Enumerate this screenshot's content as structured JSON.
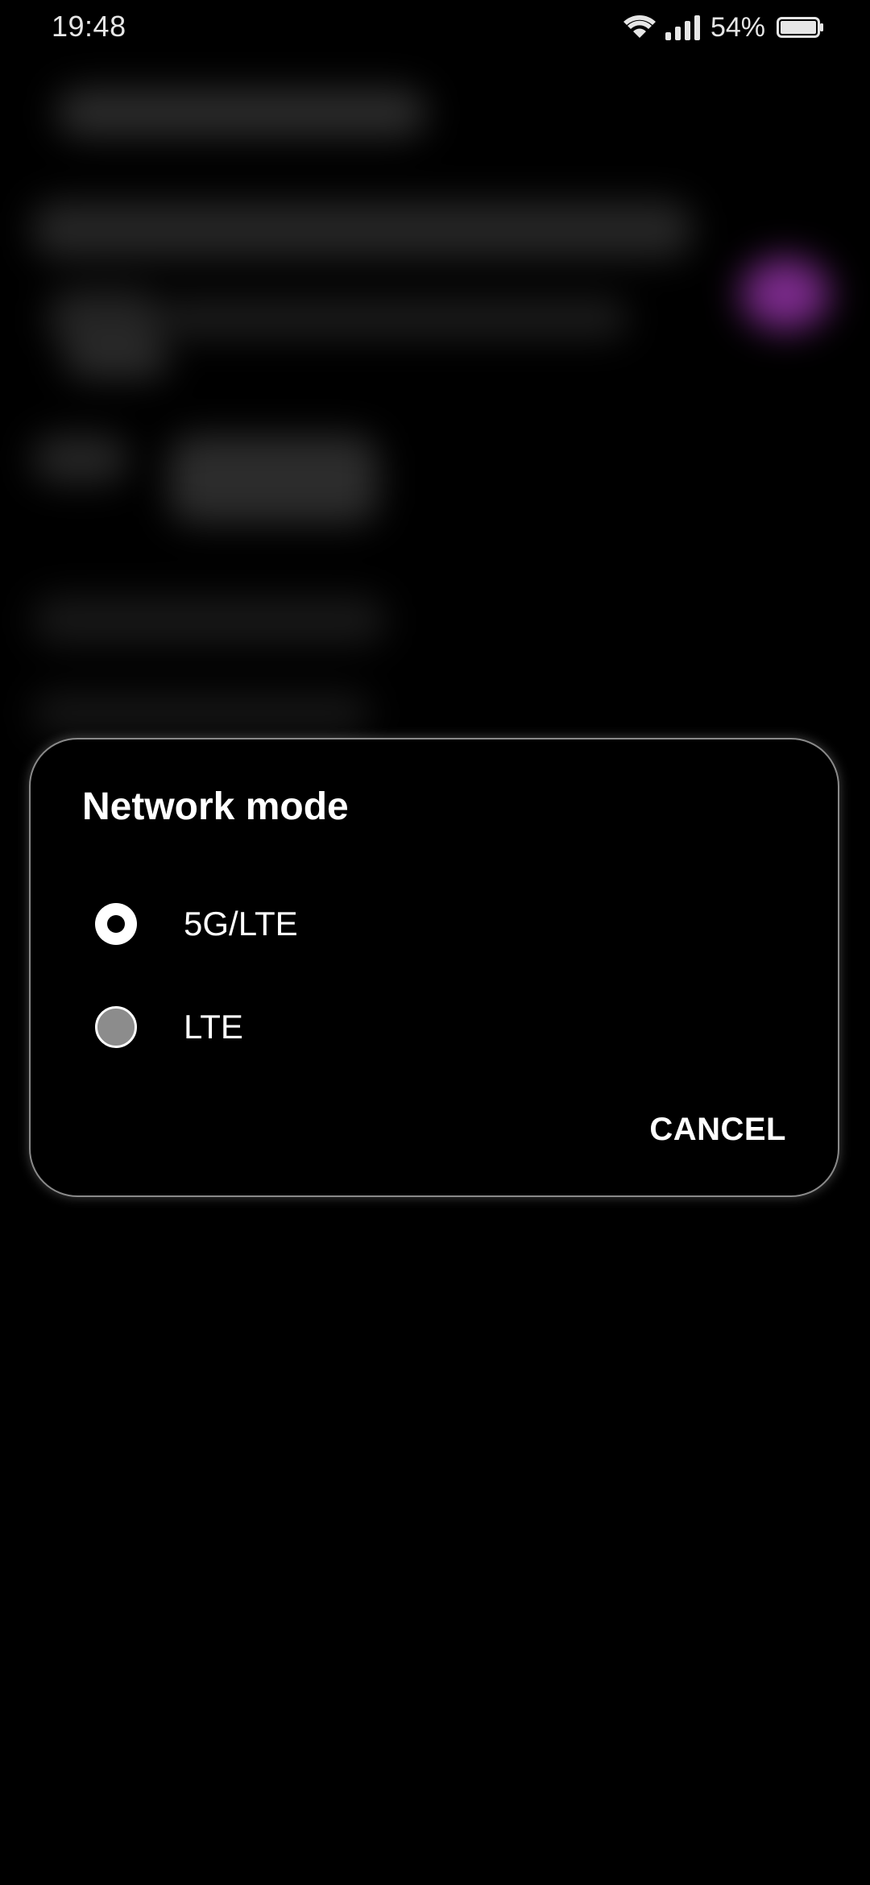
{
  "status_bar": {
    "time": "19:48",
    "battery_percent": "54%",
    "wifi_icon": "wifi-icon",
    "signal_icon": "cellular-signal-icon",
    "battery_icon": "battery-icon",
    "battery_level": 0.54
  },
  "dialog": {
    "title": "Network mode",
    "options": [
      {
        "label": "5G/LTE",
        "selected": true
      },
      {
        "label": "LTE",
        "selected": false
      }
    ],
    "cancel_label": "CANCEL"
  },
  "colors": {
    "background": "#000000",
    "dialog_border": "#8a8a8a",
    "text": "#ffffff",
    "radio_unselected_fill": "#8c8c8c",
    "accent_glow": "#7a2a8a"
  }
}
